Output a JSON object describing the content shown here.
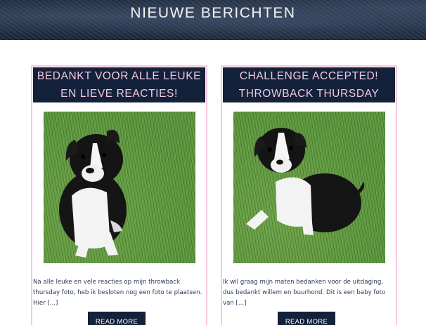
{
  "section": {
    "title": "NIEUWE BERICHTEN"
  },
  "posts": [
    {
      "title": "BEDANKT VOOR ALLE LEUKE EN LIEVE REACTIES!",
      "excerpt": "Na alle leuke en vele reacties op mijn throwback thursday foto, heb ik besloten nog een foto te plaatsen. Hier [...]",
      "button": "READ MORE",
      "image": "puppy-photo"
    },
    {
      "title": "CHALLENGE ACCEPTED! THROWBACK THURSDAY",
      "excerpt": "Ik wil graag mijn maten bedanken voor de uitdaging, dus bedankt willem en buurhond. Dit is een baby foto van [...]",
      "button": "READ MORE",
      "image": "puppy-photo"
    }
  ],
  "colors": {
    "header_bg": "#13213a",
    "header_text": "#f4c9df",
    "card_border": "#f4c9df",
    "button_bg": "#13213a"
  }
}
